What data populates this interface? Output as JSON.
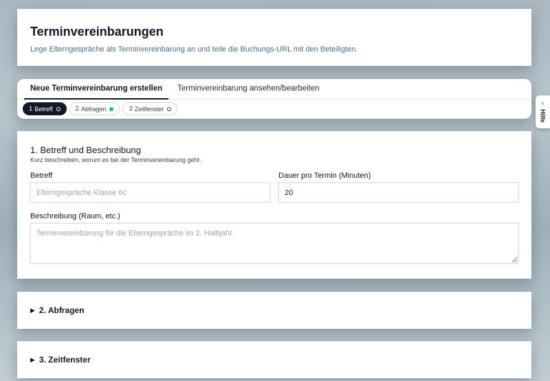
{
  "header": {
    "title": "Terminvereinbarungen",
    "subtitle": "Lege Elterngespräche als Terminvereinbarung an und teile die Buchungs-URL mit den Beteiligten."
  },
  "tabs": [
    {
      "label": "Neue Terminvereinbarung erstellen",
      "active": true
    },
    {
      "label": "Terminvereinbarung ansehen/bearbeiten",
      "active": false
    }
  ],
  "steps": [
    {
      "num": "1",
      "label": "Betreff",
      "status": "current"
    },
    {
      "num": "2",
      "label": "Abfragen",
      "status": "done"
    },
    {
      "num": "3",
      "label": "Zeitfenster",
      "status": "open"
    }
  ],
  "section1": {
    "heading": "1. Betreff und Beschreibung",
    "hint": "Kurz beschreiben, worum es bei der Terminvereinbarung geht.",
    "betreff_label": "Betreff",
    "betreff_placeholder": "Elterngespräche Klasse 6c",
    "dauer_label": "Dauer pro Termin (Minuten)",
    "dauer_value": "20",
    "beschreibung_label": "Beschreibung (Raum, etc.)",
    "beschreibung_placeholder": "Terminvereinbarung für die Elterngespräche im 2. Halbjahr."
  },
  "section2": {
    "title": "2. Abfragen",
    "icon": "triangle-right-icon"
  },
  "section3": {
    "title": "3. Zeitfenster",
    "icon": "triangle-right-icon"
  },
  "help": {
    "label": "Hilfe",
    "icon": "chevron-left-icon"
  },
  "colors": {
    "step_done": "#22c55e",
    "step_active_bg": "#111827"
  }
}
